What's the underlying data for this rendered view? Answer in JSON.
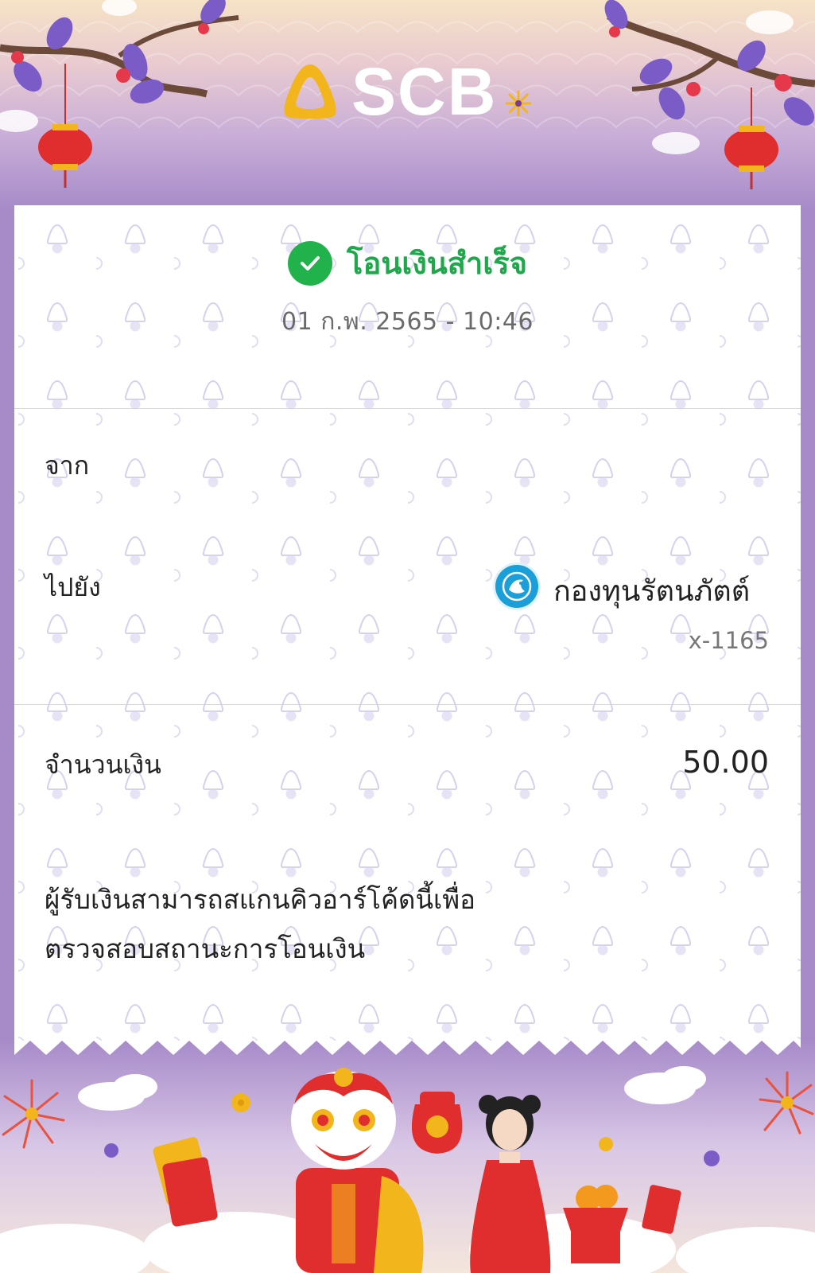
{
  "brand": {
    "logo_text": "SCB",
    "colors": {
      "purple": "#a78bc9",
      "gold": "#f2b51b",
      "success_green": "#22b24c",
      "text": "#222222",
      "muted_text": "#6a6a6a"
    }
  },
  "status": {
    "icon": "check-circle-icon",
    "text": "โอนเงินสำเร็จ",
    "datetime": "01 ก.พ. 2565 - 10:46"
  },
  "from": {
    "label": "จาก"
  },
  "to": {
    "label": "ไปยัง",
    "bank_icon": "krungthai-bank-icon",
    "name": "กองทุนรัตนภัตต์",
    "account": "x-1165"
  },
  "amount": {
    "label": "จำนวนเงิน",
    "value": "50.00"
  },
  "note": {
    "line1": "ผู้รับเงินสามารถสแกนคิวอาร์โค้ดนี้เพื่อ",
    "line2": "ตรวจสอบสถานะการโอนเงิน"
  }
}
